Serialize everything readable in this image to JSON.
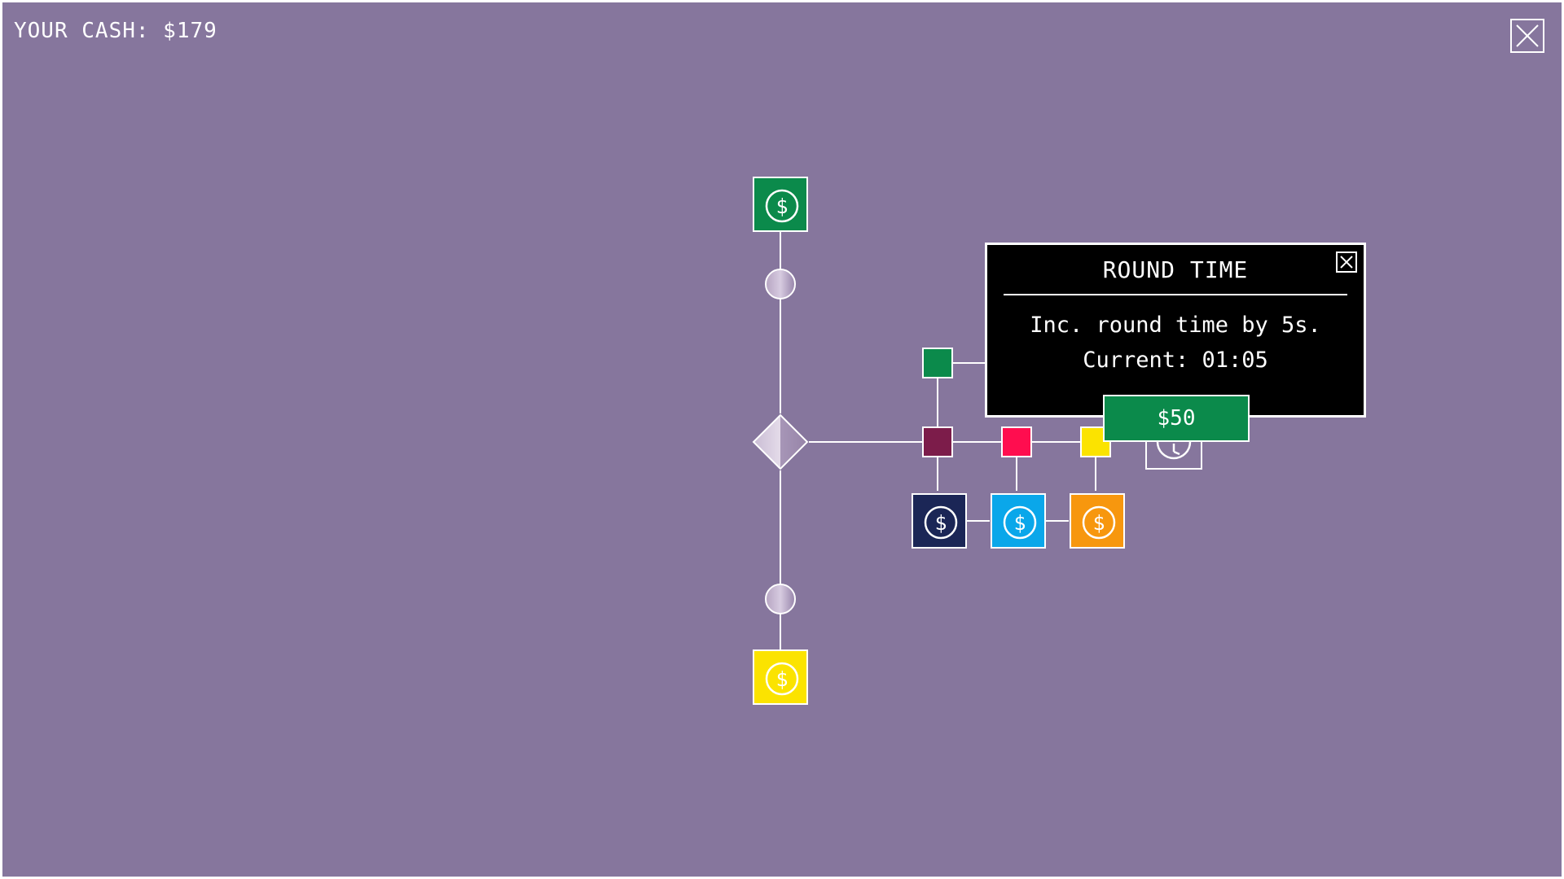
{
  "hud": {
    "cash_text": "YOUR CASH: $179"
  },
  "colors": {
    "background": "#86769d",
    "green": "#0b8a4b",
    "navy": "#1b2656",
    "cyan": "#0aa7ea",
    "orange": "#f7970e",
    "yellow": "#fbe300",
    "maroon": "#7c1c4a",
    "red": "#ff0d4f",
    "line": "#ffffff"
  },
  "popup": {
    "title": "ROUND TIME",
    "description": "Inc. round time by 5s.",
    "current": "Current: 01:05",
    "price": "$50"
  },
  "icons": {
    "close": "close-x-icon",
    "coin": "dollar-coin-icon",
    "clock": "clock-icon"
  }
}
